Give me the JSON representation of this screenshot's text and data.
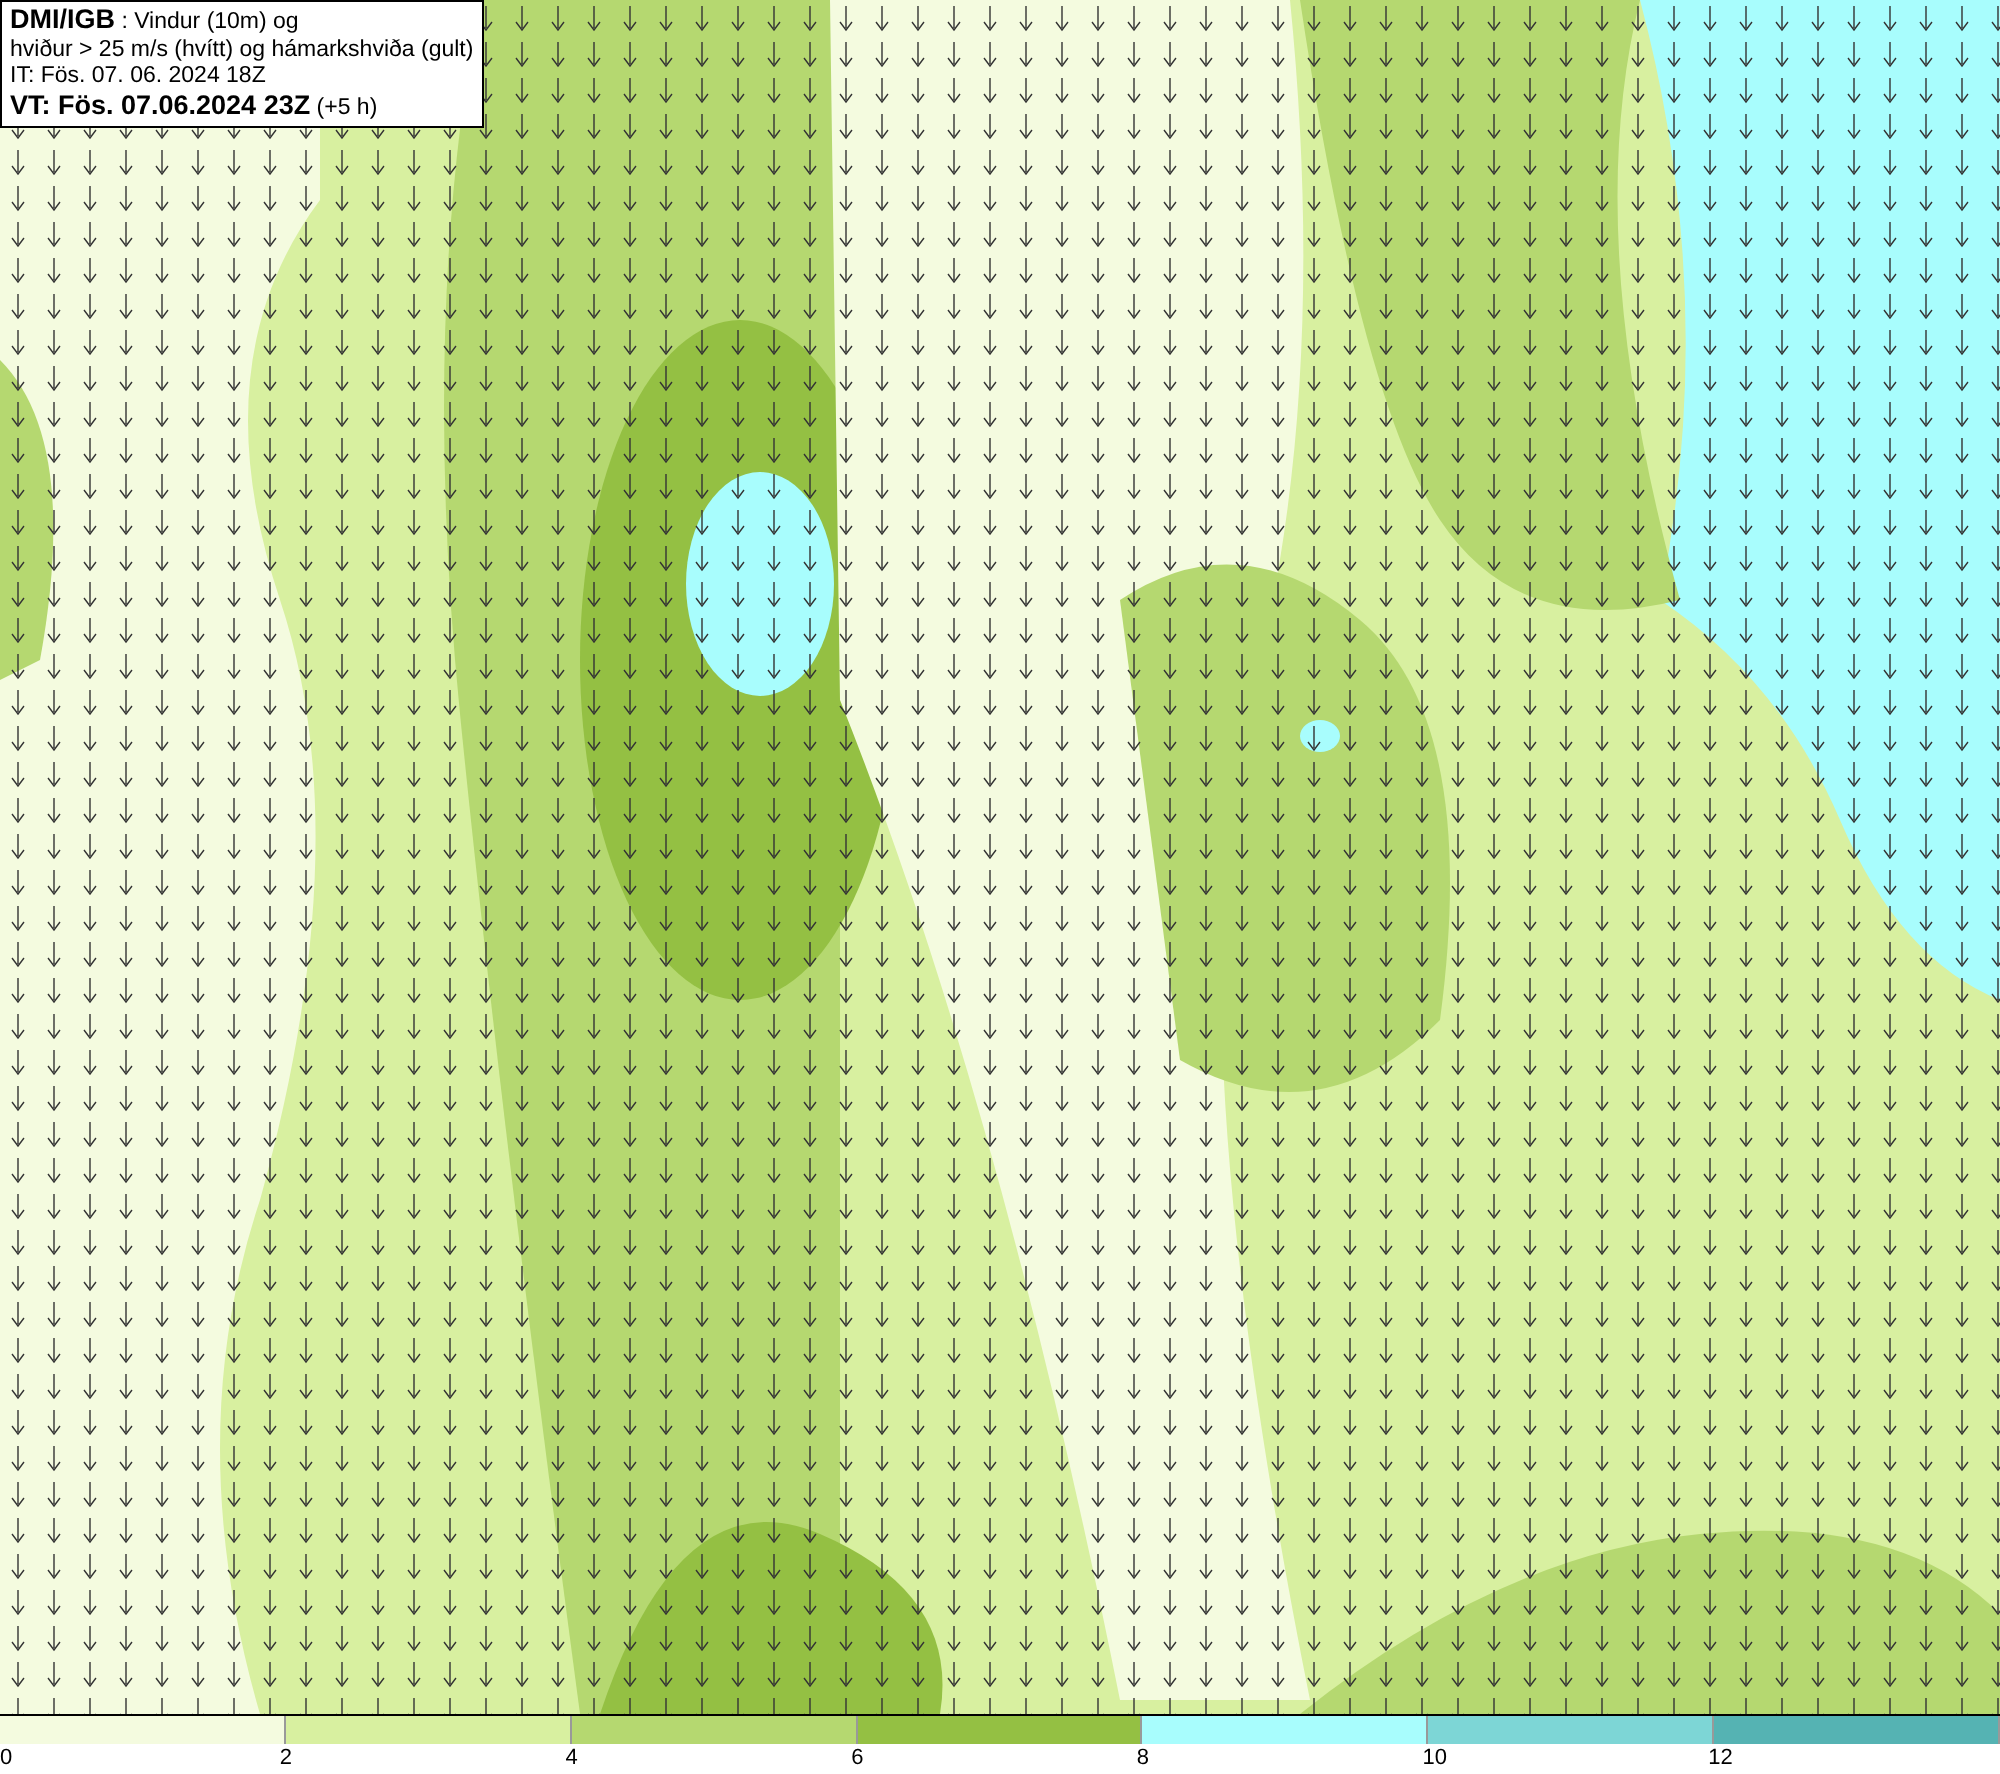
{
  "info_box": {
    "lines": [
      "**DMI/IGB** : Vindur (10m) og",
      "hviður > 25 m/s (hvítt) og hámarkshviða (gult)",
      "IT: Fös. 07. 06. 2024 18Z",
      "**VT: Fös. 07.06.2024 23Z** (+5 h)"
    ]
  },
  "legend": {
    "segments": [
      {
        "color": "#f4fbdf"
      },
      {
        "color": "#d8f0a0"
      },
      {
        "color": "#b5d870"
      },
      {
        "color": "#94c043"
      },
      {
        "color": "#a8fdfd"
      },
      {
        "color": "#7dd6d6"
      },
      {
        "color": "#55b3b3"
      }
    ],
    "labels": [
      "0",
      "2",
      "4",
      "6",
      "8",
      "10",
      "12"
    ]
  }
}
